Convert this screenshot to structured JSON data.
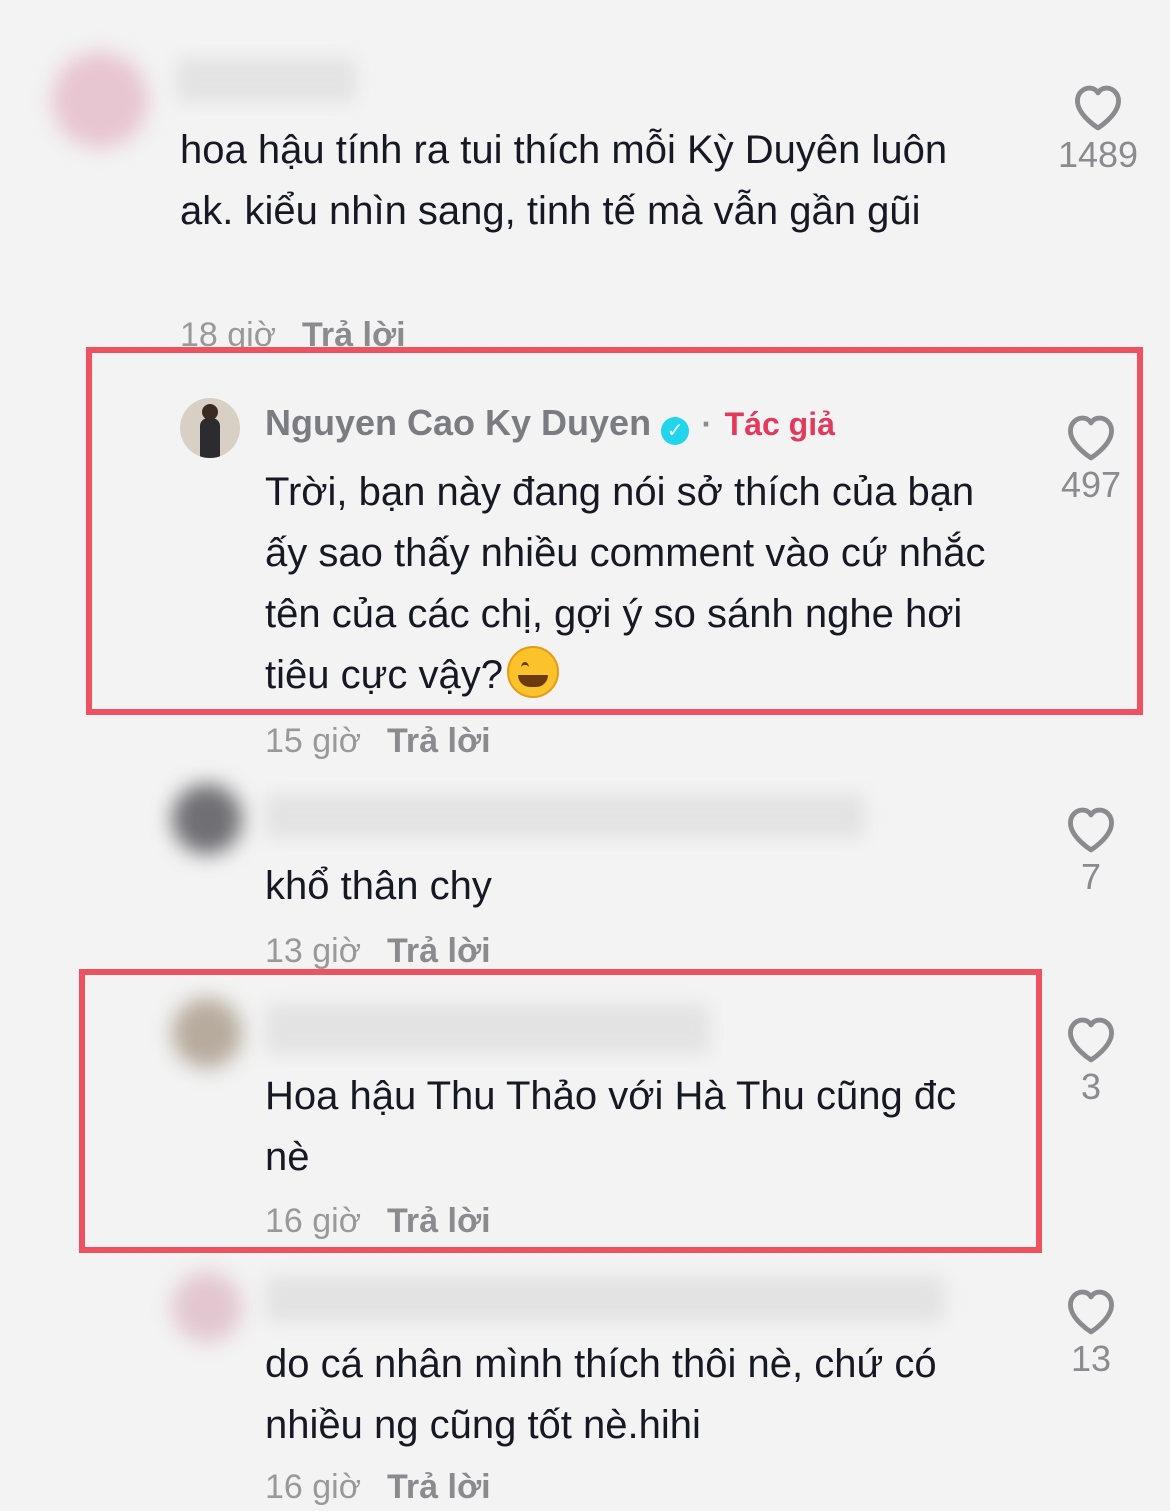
{
  "comments": [
    {
      "text": "hoa hậu tính ra tui thích mỗi Kỳ Duyên luôn ak. kiểu nhìn sang, tinh tế mà vẫn gần gũi",
      "time": "18 giờ",
      "reply": "Trả lời",
      "likes": "1489"
    },
    {
      "author": "Nguyen Cao Ky Duyen",
      "separator": "·",
      "author_tag": "Tác giả",
      "text": "Trời, bạn này đang nói sở thích của bạn ấy sao thấy nhiều comment vào cứ nhắc tên của các chị, gợi ý so sánh nghe hơi tiêu cực vậy?",
      "emoji": "grinning-sweat-emoji",
      "time": "15 giờ",
      "reply": "Trả lời",
      "likes": "497"
    },
    {
      "text": "khổ thân chy",
      "time": "13 giờ",
      "reply": "Trả lời",
      "likes": "7"
    },
    {
      "text": "Hoa hậu Thu Thảo với Hà Thu cũng đc nè",
      "time": "16 giờ",
      "reply": "Trả lời",
      "likes": "3"
    },
    {
      "text": "do cá nhân mình thích thôi nè, chứ có nhiều ng cũng tốt nè.hihi",
      "time": "16 giờ",
      "reply": "Trả lời",
      "likes": "13"
    }
  ],
  "colors": {
    "background": "#f3f3f3",
    "highlight_border": "#ee5160",
    "author_tag": "#e23a5c",
    "verified": "#20d5ec"
  },
  "icons": [
    "heart-outline-icon",
    "verified-badge-icon"
  ]
}
